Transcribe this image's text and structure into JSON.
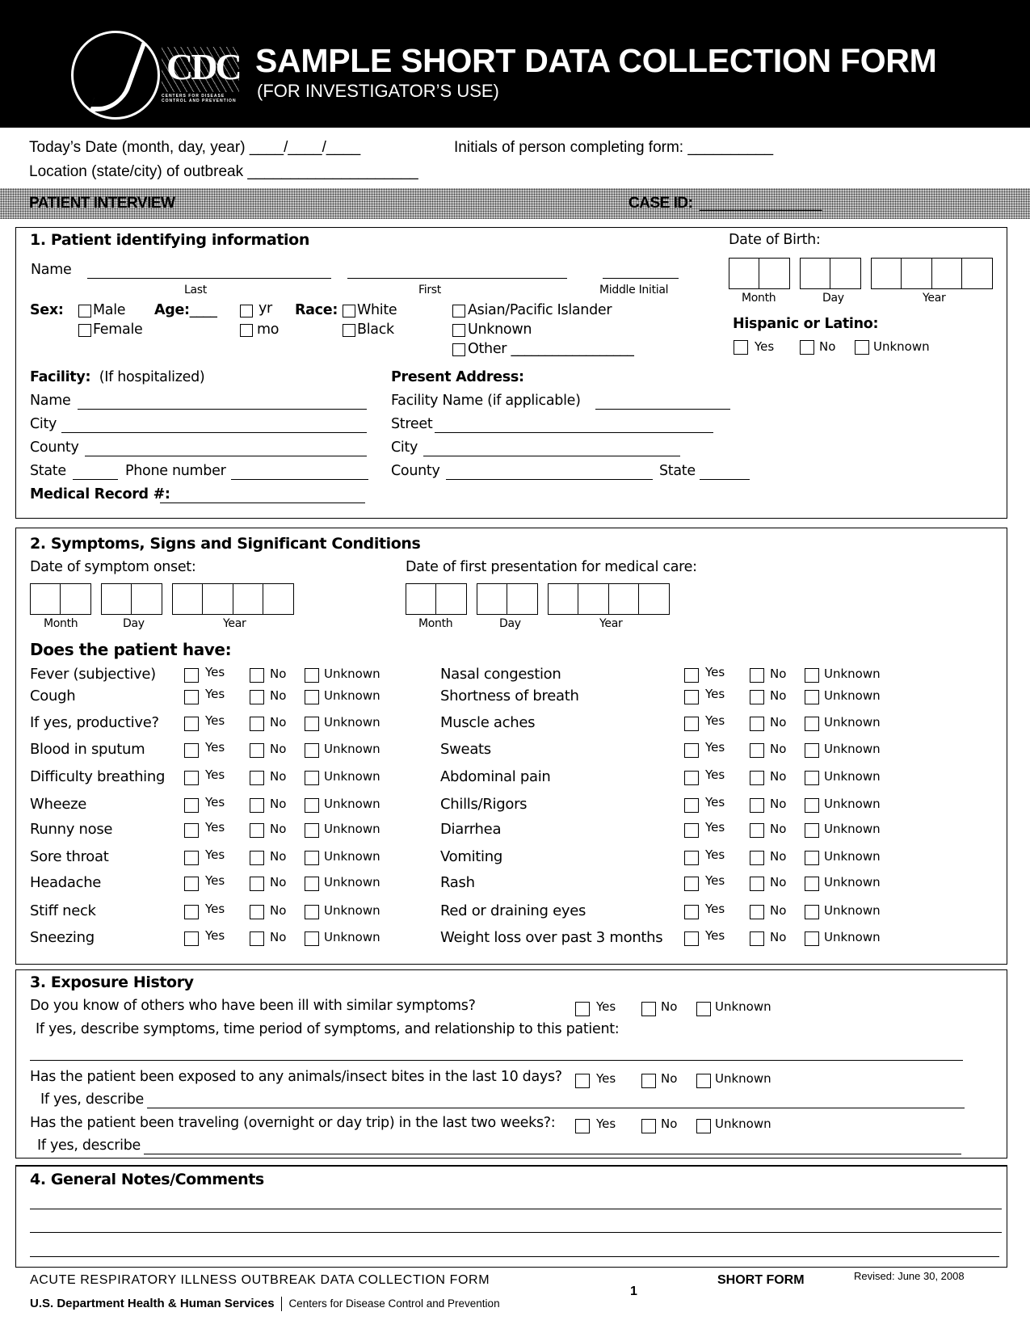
{
  "header": {
    "title": "SAMPLE SHORT DATA COLLECTION FORM",
    "subtitle": "(FOR INVESTIGATOR’S USE)",
    "hhs_seal_icon": "hhs-eagle-seal",
    "cdc_logo": "CDC",
    "cdc_logo_sub_line1": "CENTERS FOR DISEASE",
    "cdc_logo_sub_line2": "CONTROL AND PREVENTION"
  },
  "top_fields": {
    "todays_date_label": "Today’s Date (month, day, year)",
    "todays_date_value": "____/____/____",
    "initials_label": "Initials of person completing form:",
    "initials_value": "__________",
    "location_label": "Location (state/city) of outbreak",
    "location_value": "____________________"
  },
  "patient_interview_bar": {
    "label": "PATIENT INTERVIEW",
    "case_id_label": "CASE ID:",
    "case_id_value": "_______________"
  },
  "section1": {
    "title": "1. Patient identifying information",
    "name_label": "Name",
    "name_last": "Last",
    "name_first": "First",
    "name_middle": "Middle Initial",
    "sex_label": "Sex:",
    "sex_options": [
      "Male",
      "Female"
    ],
    "age_label": "Age:",
    "age_value": "____",
    "age_units": [
      "yr",
      "mo"
    ],
    "race_label": "Race:",
    "race_options": [
      "White",
      "Black",
      "Asian/Pacific Islander",
      "Unknown",
      "Other"
    ],
    "race_other_value": "__________________",
    "dob_label": "Date of Birth:",
    "dob_parts": [
      "Month",
      "Day",
      "Year"
    ],
    "hispanic_label": "Hispanic or Latino:",
    "hispanic_options": [
      "Yes",
      "No",
      "Unknown"
    ],
    "facility_label": "Facility:",
    "facility_note": "(If hospitalized)",
    "facility_fields": [
      "Name",
      "City",
      "County",
      "State",
      "Phone number"
    ],
    "medical_record_label": "Medical Record #:",
    "address_label": "Present Address:",
    "address_fields": [
      "Facility Name (if applicable)",
      "Street",
      "City",
      "County",
      "State"
    ]
  },
  "section2": {
    "title": "2. Symptoms, Signs and Significant Conditions",
    "onset_label": "Date of symptom onset:",
    "presentation_label": "Date of first presentation for medical care:",
    "date_parts": [
      "Month",
      "Day",
      "Year"
    ],
    "question": "Does the patient have:",
    "answer_options": [
      "Yes",
      "No",
      "Unknown"
    ],
    "symptoms_left": [
      "Fever (subjective)",
      "Cough",
      "If yes, productive?",
      "Blood in sputum",
      "Difficulty breathing",
      "Wheeze",
      "Runny nose",
      "Sore throat",
      "Headache",
      "Stiff neck",
      "Sneezing"
    ],
    "symptoms_right": [
      "Nasal congestion",
      "Shortness of breath",
      "Muscle aches",
      "Sweats",
      "Abdominal pain",
      "Chills/Rigors",
      "Diarrhea",
      "Vomiting",
      "Rash",
      "Red or draining eyes",
      "Weight loss over past 3 months"
    ]
  },
  "section3": {
    "title": "3. Exposure History",
    "q1": "Do you know of others who have been ill with similar symptoms?",
    "q1_followup": "If yes, describe symptoms, time period of symptoms, and relationship to this patient:",
    "q2": "Has the patient been exposed to any animals/insect bites in the last 10 days?",
    "q2_followup": "If yes, describe",
    "q3": "Has the patient been traveling (overnight or day trip) in the last two weeks?:",
    "q3_followup": "If yes, describe",
    "answer_options": [
      "Yes",
      "No",
      "Unknown"
    ]
  },
  "section4": {
    "title": "4. General Notes/Comments"
  },
  "footer": {
    "form_name": "ACUTE RESPIRATORY ILLNESS OUTBREAK DATA COLLECTION FORM",
    "form_type": "SHORT FORM",
    "revised": "Revised: June 30, 2008",
    "page_number": "1",
    "dept": "U.S. Department Health & Human Services",
    "cdc": "Centers for Disease Control and Prevention"
  }
}
